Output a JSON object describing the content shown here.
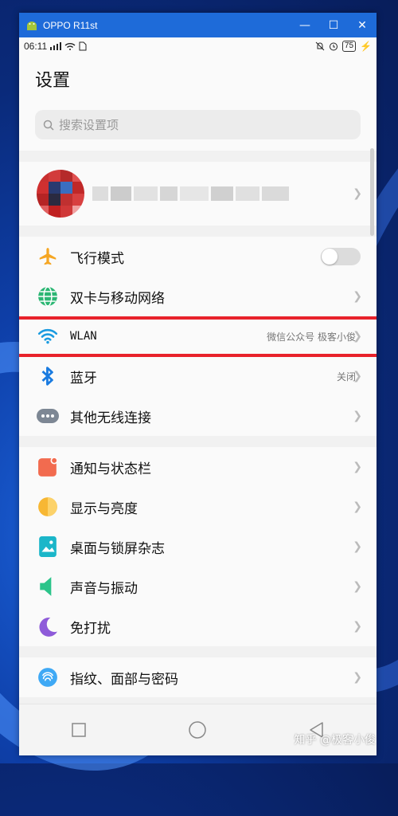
{
  "window": {
    "title": "OPPO R11st"
  },
  "status": {
    "time": "06:11",
    "battery": "75"
  },
  "header": {
    "title": "设置"
  },
  "search": {
    "placeholder": "搜索设置项"
  },
  "group1": [
    {
      "label": "飞行模式",
      "icon": "airplane-icon",
      "toggle": false
    },
    {
      "label": "双卡与移动网络",
      "icon": "globe-icon"
    },
    {
      "label": "WLAN",
      "icon": "wifi-icon",
      "value": "微信公众号 极客小俊"
    },
    {
      "label": "蓝牙",
      "icon": "bluetooth-icon",
      "value": "关闭"
    },
    {
      "label": "其他无线连接",
      "icon": "more-dots-icon"
    }
  ],
  "group2": [
    {
      "label": "通知与状态栏",
      "icon": "notification-icon"
    },
    {
      "label": "显示与亮度",
      "icon": "brightness-icon"
    },
    {
      "label": "桌面与锁屏杂志",
      "icon": "wallpaper-icon"
    },
    {
      "label": "声音与振动",
      "icon": "sound-icon"
    },
    {
      "label": "免打扰",
      "icon": "moon-icon"
    }
  ],
  "group3": [
    {
      "label": "指纹、面部与密码",
      "icon": "fingerprint-icon"
    }
  ],
  "watermark": "知乎 @极客小俊",
  "colors": {
    "accent": "#1e6bd9",
    "highlight": "#e8222b",
    "airplane": "#f5a623",
    "globe": "#2bb673",
    "wifi": "#1a9be0",
    "bluetooth": "#1a7be0"
  }
}
